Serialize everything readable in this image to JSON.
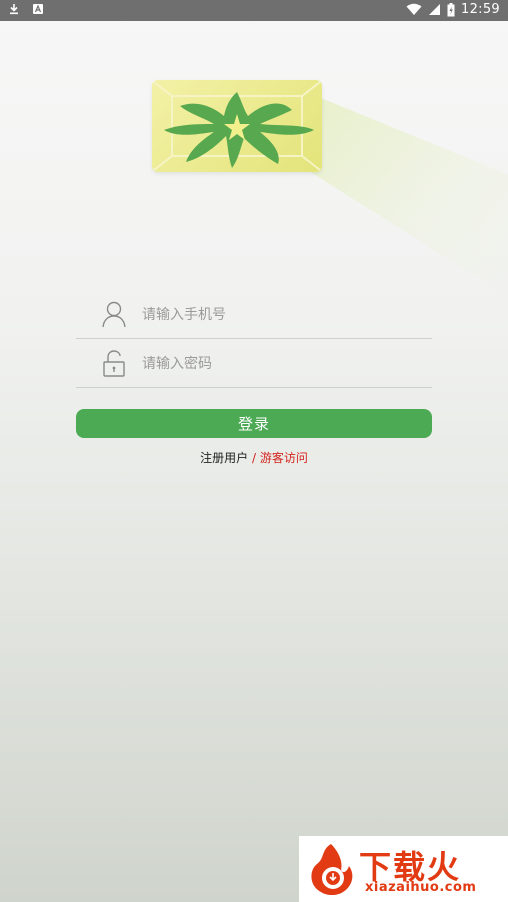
{
  "status_bar": {
    "time": "12:59",
    "left_icons": [
      "download-icon",
      "notification-a-icon"
    ],
    "right_icons": [
      "wifi-icon",
      "signal-icon",
      "battery-icon"
    ]
  },
  "login_form": {
    "phone_placeholder": "请输入手机号",
    "password_placeholder": "请输入密码",
    "login_label": "登录"
  },
  "links": {
    "register": "注册用户",
    "separator": " / ",
    "guest": "游客访问"
  },
  "watermark": {
    "title": "下载火",
    "url": "xiazaihuo.com"
  },
  "colors": {
    "accent": "#4caa55",
    "guest_link": "#d4241f",
    "logo_green": "#58a84f",
    "logo_bg": "#e8e88a"
  }
}
